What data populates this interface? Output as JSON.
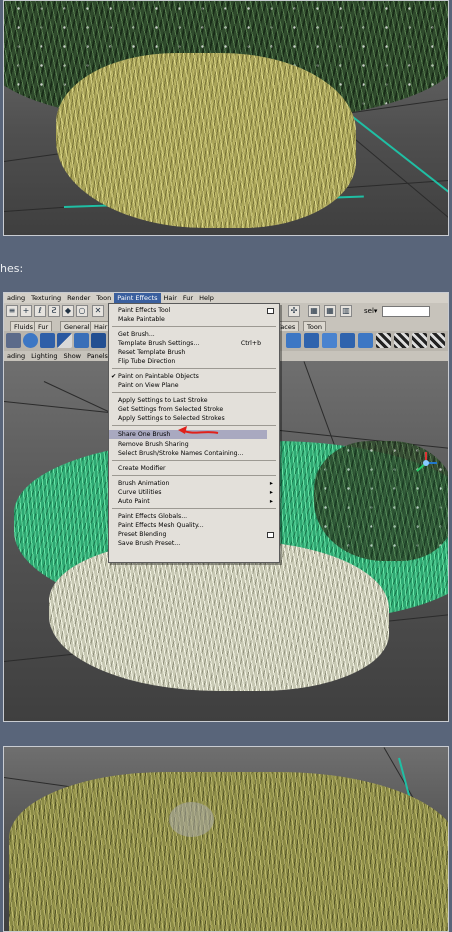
{
  "caption": "hes:",
  "menubar": {
    "items": [
      "ading",
      "Texturing",
      "Render",
      "Toon",
      "Paint Effects",
      "Hair",
      "Fur",
      "Help"
    ],
    "active_index": 4
  },
  "status_line": {
    "sel_label": "sel▾"
  },
  "shelf_tabs": [
    "Fluids",
    "Fur",
    "General",
    "Hair",
    "faces",
    "Toon"
  ],
  "panel_menu": [
    "ading",
    "Lighting",
    "Show",
    "Panels"
  ],
  "paint_effects_menu": {
    "items": [
      {
        "label": "Paint Effects Tool",
        "option_box": true
      },
      {
        "label": "Make Paintable"
      },
      {
        "label": "Get Brush..."
      },
      {
        "label": "Template Brush Settings...",
        "shortcut": "Ctrl+b"
      },
      {
        "label": "Reset Template Brush"
      },
      {
        "label": "Flip Tube Direction"
      },
      {
        "label": "Paint on Paintable Objects",
        "checked": true
      },
      {
        "label": "Paint on View Plane"
      },
      {
        "label": "Apply Settings to Last Stroke"
      },
      {
        "label": "Get Settings from Selected Stroke"
      },
      {
        "label": "Apply Settings to Selected Strokes"
      },
      {
        "label": "Share One Brush",
        "highlighted": true
      },
      {
        "label": "Remove Brush Sharing"
      },
      {
        "label": "Select Brush/Stroke Names Containing..."
      },
      {
        "label": "Create Modifier"
      },
      {
        "label": "Brush Animation",
        "submenu": true
      },
      {
        "label": "Curve Utilities",
        "submenu": true
      },
      {
        "label": "Auto Paint",
        "submenu": true
      },
      {
        "label": "Paint Effects Globals..."
      },
      {
        "label": "Paint Effects Mesh Quality..."
      },
      {
        "label": "Preset Blending",
        "option_box": true
      },
      {
        "label": "Save Brush Preset..."
      }
    ]
  },
  "colors": {
    "page_bg": "#59657a",
    "menu_highlight": "#a9a9c0",
    "annotation_arrow": "#e0201a",
    "grid_highlight": "#1fbfa4"
  }
}
